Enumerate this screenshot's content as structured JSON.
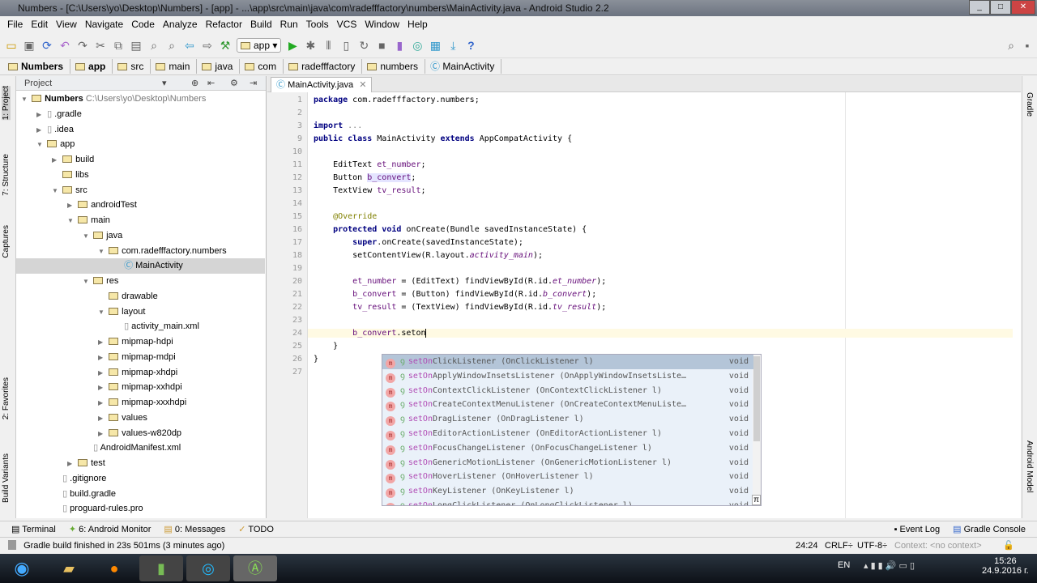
{
  "window": {
    "title": "Numbers - [C:\\Users\\yo\\Desktop\\Numbers] - [app] - ...\\app\\src\\main\\java\\com\\radefffactory\\numbers\\MainActivity.java - Android Studio 2.2"
  },
  "menu": [
    "File",
    "Edit",
    "View",
    "Navigate",
    "Code",
    "Analyze",
    "Refactor",
    "Build",
    "Run",
    "Tools",
    "VCS",
    "Window",
    "Help"
  ],
  "toolbar": {
    "run_config": "app"
  },
  "breadcrumbs": [
    "Numbers",
    "app",
    "src",
    "main",
    "java",
    "com",
    "radefffactory",
    "numbers",
    "MainActivity"
  ],
  "side_tabs": {
    "left": [
      "1: Project",
      "7: Structure",
      "Captures",
      "2: Favorites",
      "Build Variants"
    ],
    "right": [
      "Gradle",
      "Android Model"
    ]
  },
  "project": {
    "header": "Project",
    "tree": [
      {
        "label": "Numbers",
        "extra": "C:\\Users\\yo\\Desktop\\Numbers",
        "depth": 0,
        "arrow": "▼"
      },
      {
        "label": ".gradle",
        "depth": 1,
        "arrow": "▶"
      },
      {
        "label": ".idea",
        "depth": 1,
        "arrow": "▶"
      },
      {
        "label": "app",
        "depth": 1,
        "arrow": "▼"
      },
      {
        "label": "build",
        "depth": 2,
        "arrow": "▶"
      },
      {
        "label": "libs",
        "depth": 2,
        "arrow": ""
      },
      {
        "label": "src",
        "depth": 2,
        "arrow": "▼"
      },
      {
        "label": "androidTest",
        "depth": 3,
        "arrow": "▶"
      },
      {
        "label": "main",
        "depth": 3,
        "arrow": "▼"
      },
      {
        "label": "java",
        "depth": 4,
        "arrow": "▼"
      },
      {
        "label": "com.radefffactory.numbers",
        "depth": 5,
        "arrow": "▼"
      },
      {
        "label": "MainActivity",
        "depth": 6,
        "arrow": "",
        "selected": true
      },
      {
        "label": "res",
        "depth": 4,
        "arrow": "▼"
      },
      {
        "label": "drawable",
        "depth": 5,
        "arrow": ""
      },
      {
        "label": "layout",
        "depth": 5,
        "arrow": "▼"
      },
      {
        "label": "activity_main.xml",
        "depth": 6,
        "arrow": ""
      },
      {
        "label": "mipmap-hdpi",
        "depth": 5,
        "arrow": "▶"
      },
      {
        "label": "mipmap-mdpi",
        "depth": 5,
        "arrow": "▶"
      },
      {
        "label": "mipmap-xhdpi",
        "depth": 5,
        "arrow": "▶"
      },
      {
        "label": "mipmap-xxhdpi",
        "depth": 5,
        "arrow": "▶"
      },
      {
        "label": "mipmap-xxxhdpi",
        "depth": 5,
        "arrow": "▶"
      },
      {
        "label": "values",
        "depth": 5,
        "arrow": "▶"
      },
      {
        "label": "values-w820dp",
        "depth": 5,
        "arrow": "▶"
      },
      {
        "label": "AndroidManifest.xml",
        "depth": 4,
        "arrow": ""
      },
      {
        "label": "test",
        "depth": 3,
        "arrow": "▶"
      },
      {
        "label": ".gitignore",
        "depth": 2,
        "arrow": ""
      },
      {
        "label": "build.gradle",
        "depth": 2,
        "arrow": ""
      },
      {
        "label": "proguard-rules.pro",
        "depth": 2,
        "arrow": ""
      }
    ]
  },
  "editor": {
    "tab": "MainActivity.java",
    "lines": [
      {
        "n": "1",
        "html": "<span class='kw'>package</span> com.radefffactory.numbers;"
      },
      {
        "n": "2",
        "html": ""
      },
      {
        "n": "3",
        "html": "<span class='kw'>import</span> <span style='color:#808080'>...</span>"
      },
      {
        "n": "9",
        "html": "<span class='kw'>public class</span> MainActivity <span class='kw'>extends</span> AppCompatActivity {"
      },
      {
        "n": "10",
        "html": ""
      },
      {
        "n": "11",
        "html": "    EditText <span class='fld'>et_number</span>;"
      },
      {
        "n": "12",
        "html": "    Button <span class='fld' style='background:#e4e4ff'>b_convert</span>;"
      },
      {
        "n": "13",
        "html": "    TextView <span class='fld'>tv_result</span>;"
      },
      {
        "n": "14",
        "html": ""
      },
      {
        "n": "15",
        "html": "    <span class='ann'>@Override</span>"
      },
      {
        "n": "16",
        "html": "    <span class='kw'>protected void</span> onCreate(Bundle savedInstanceState) {"
      },
      {
        "n": "17",
        "html": "        <span class='kw'>super</span>.onCreate(savedInstanceState);"
      },
      {
        "n": "18",
        "html": "        setContentView(R.layout.<span class='fld it'>activity_main</span>);"
      },
      {
        "n": "19",
        "html": ""
      },
      {
        "n": "20",
        "html": "        <span class='fld'>et_number</span> = (EditText) findViewById(R.id.<span class='fld it'>et_number</span>);"
      },
      {
        "n": "21",
        "html": "        <span class='fld'>b_convert</span> = (Button) findViewById(R.id.<span class='fld it'>b_convert</span>);"
      },
      {
        "n": "22",
        "html": "        <span class='fld'>tv_result</span> = (TextView) findViewById(R.id.<span class='fld it'>tv_result</span>);"
      },
      {
        "n": "23",
        "html": ""
      },
      {
        "n": "24",
        "html": "        <span class='fld'>b_convert</span>.seton<span style='border-left:1px solid #000'></span>"
      },
      {
        "n": "25",
        "html": "    }"
      },
      {
        "n": "26",
        "html": "}"
      },
      {
        "n": "27",
        "html": ""
      }
    ]
  },
  "completion": {
    "items": [
      {
        "name": "setOnClickListener",
        "args": "(OnClickListener l)",
        "type": "void"
      },
      {
        "name": "setOnApplyWindowInsetsListener",
        "args": "(OnApplyWindowInsetsListe…",
        "type": "void"
      },
      {
        "name": "setOnContextClickListener",
        "args": "(OnContextClickListener l)",
        "type": "void"
      },
      {
        "name": "setOnCreateContextMenuListener",
        "args": "(OnCreateContextMenuListe…",
        "type": "void"
      },
      {
        "name": "setOnDragListener",
        "args": "(OnDragListener l)",
        "type": "void"
      },
      {
        "name": "setOnEditorActionListener",
        "args": "(OnEditorActionListener l)",
        "type": "void"
      },
      {
        "name": "setOnFocusChangeListener",
        "args": "(OnFocusChangeListener l)",
        "type": "void"
      },
      {
        "name": "setOnGenericMotionListener",
        "args": "(OnGenericMotionListener l)",
        "type": "void"
      },
      {
        "name": "setOnHoverListener",
        "args": "(OnHoverListener l)",
        "type": "void"
      },
      {
        "name": "setOnKeyListener",
        "args": "(OnKeyListener l)",
        "type": "void"
      },
      {
        "name": "setOnLongClickListener",
        "args": "(OnLongClickListener l)",
        "type": "void"
      }
    ],
    "pi": "π"
  },
  "bottom_tools": {
    "left": [
      "Terminal",
      "6: Android Monitor",
      "0: Messages",
      "TODO"
    ],
    "right": [
      "Event Log",
      "Gradle Console"
    ]
  },
  "status": {
    "message": "Gradle build finished in 23s 501ms (3 minutes ago)",
    "position": "24:24",
    "line_sep": "CRLF",
    "encoding": "UTF-8",
    "context": "Context: <no context>"
  },
  "taskbar": {
    "lang": "EN",
    "time": "15:26",
    "date": "24.9.2016 г."
  }
}
